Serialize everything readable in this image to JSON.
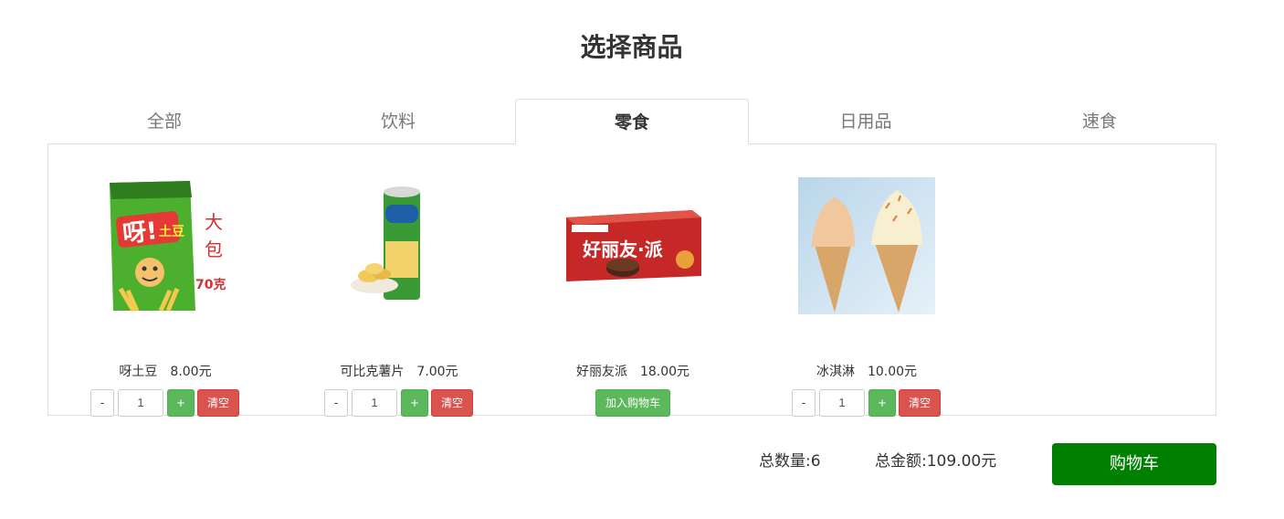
{
  "page_title": "选择商品",
  "tabs": [
    {
      "label": "全部",
      "active": false
    },
    {
      "label": "饮料",
      "active": false
    },
    {
      "label": "零食",
      "active": true
    },
    {
      "label": "日用品",
      "active": false
    },
    {
      "label": "速食",
      "active": false
    }
  ],
  "products": [
    {
      "name": "呀土豆",
      "price": "8.00元",
      "image_icon": "ya-tudou-chips-bag-icon",
      "image_text": [
        "大",
        "包",
        "70克"
      ],
      "quantity": "1",
      "minus_label": "-",
      "plus_label": "+",
      "clear_label": "清空"
    },
    {
      "name": "可比克薯片",
      "price": "7.00元",
      "image_icon": "kebike-chips-can-icon",
      "quantity": "1",
      "minus_label": "-",
      "plus_label": "+",
      "clear_label": "清空"
    },
    {
      "name": "好丽友派",
      "price": "18.00元",
      "image_icon": "orion-choco-pie-box-icon",
      "add_label": "加入购物车"
    },
    {
      "name": "冰淇淋",
      "price": "10.00元",
      "image_icon": "ice-cream-cones-icon",
      "quantity": "1",
      "minus_label": "-",
      "plus_label": "+",
      "clear_label": "清空"
    }
  ],
  "summary": {
    "count_label": "总数量:",
    "count_value": "6",
    "amount_label": "总金额:",
    "amount_value": "109.00元"
  },
  "cart_button_label": "购物车",
  "colors": {
    "green": "#5cb85c",
    "red": "#d9534f",
    "cart_green": "#008000"
  }
}
